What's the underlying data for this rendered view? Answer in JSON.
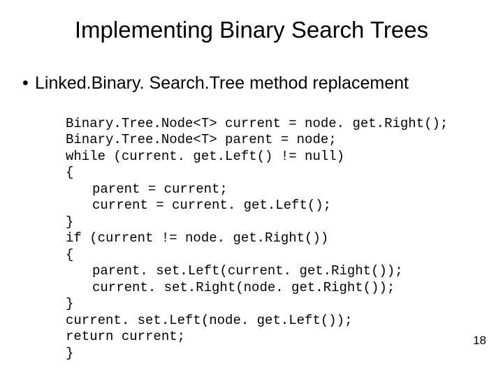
{
  "title": "Implementing Binary Search Trees",
  "bullet": "Linked.Binary. Search.Tree method replacement",
  "code": {
    "l1": "Binary.Tree.Node<T> current = node. get.Right();",
    "l2": "Binary.Tree.Node<T> parent = node;",
    "l3": "while (current. get.Left() != null)",
    "l4": "{",
    "l5": "parent = current;",
    "l6": "current = current. get.Left();",
    "l7": "}",
    "l8": "if (current != node. get.Right())",
    "l9": "{",
    "l10": "parent. set.Left(current. get.Right());",
    "l11": "current. set.Right(node. get.Right());",
    "l12": "}",
    "l13": "current. set.Left(node. get.Left());",
    "l14": "return current;",
    "l15": "}"
  },
  "page_number": "18"
}
